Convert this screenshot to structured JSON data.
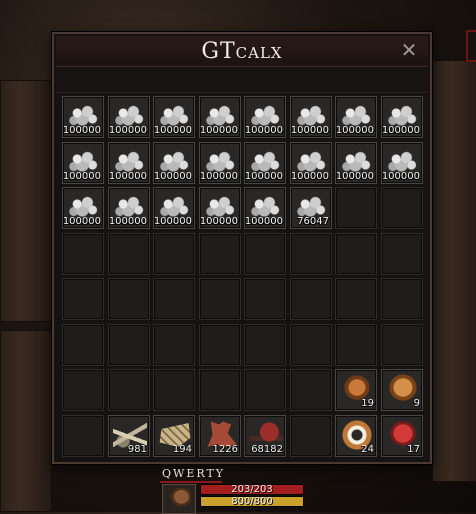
{
  "window": {
    "title": "GTcalx",
    "close_icon": "close-icon"
  },
  "inventory": {
    "columns": 8,
    "rows": 8,
    "slots": [
      {
        "row": 0,
        "col": 0,
        "icon": "ore",
        "qty": "100000"
      },
      {
        "row": 0,
        "col": 1,
        "icon": "ore",
        "qty": "100000"
      },
      {
        "row": 0,
        "col": 2,
        "icon": "ore",
        "qty": "100000"
      },
      {
        "row": 0,
        "col": 3,
        "icon": "ore",
        "qty": "100000"
      },
      {
        "row": 0,
        "col": 4,
        "icon": "ore",
        "qty": "100000"
      },
      {
        "row": 0,
        "col": 5,
        "icon": "ore",
        "qty": "100000"
      },
      {
        "row": 0,
        "col": 6,
        "icon": "ore",
        "qty": "100000"
      },
      {
        "row": 0,
        "col": 7,
        "icon": "ore",
        "qty": "100000"
      },
      {
        "row": 1,
        "col": 0,
        "icon": "ore",
        "qty": "100000"
      },
      {
        "row": 1,
        "col": 1,
        "icon": "ore",
        "qty": "100000"
      },
      {
        "row": 1,
        "col": 2,
        "icon": "ore",
        "qty": "100000"
      },
      {
        "row": 1,
        "col": 3,
        "icon": "ore",
        "qty": "100000"
      },
      {
        "row": 1,
        "col": 4,
        "icon": "ore",
        "qty": "100000"
      },
      {
        "row": 1,
        "col": 5,
        "icon": "ore",
        "qty": "100000"
      },
      {
        "row": 1,
        "col": 6,
        "icon": "ore",
        "qty": "100000"
      },
      {
        "row": 1,
        "col": 7,
        "icon": "ore",
        "qty": "100000"
      },
      {
        "row": 2,
        "col": 0,
        "icon": "ore",
        "qty": "100000"
      },
      {
        "row": 2,
        "col": 1,
        "icon": "ore",
        "qty": "100000"
      },
      {
        "row": 2,
        "col": 2,
        "icon": "ore",
        "qty": "100000"
      },
      {
        "row": 2,
        "col": 3,
        "icon": "ore",
        "qty": "100000"
      },
      {
        "row": 2,
        "col": 4,
        "icon": "ore",
        "qty": "100000"
      },
      {
        "row": 2,
        "col": 5,
        "icon": "ore",
        "qty": "76047"
      },
      {
        "row": 6,
        "col": 6,
        "icon": "meat",
        "qty": "19"
      },
      {
        "row": 6,
        "col": 7,
        "icon": "meat2",
        "qty": "9"
      },
      {
        "row": 7,
        "col": 1,
        "icon": "bones",
        "qty": "981"
      },
      {
        "row": 7,
        "col": 2,
        "icon": "logs",
        "qty": "194"
      },
      {
        "row": 7,
        "col": 3,
        "icon": "leather",
        "qty": "1226"
      },
      {
        "row": 7,
        "col": 4,
        "icon": "hide",
        "qty": "68182"
      },
      {
        "row": 7,
        "col": 6,
        "icon": "donut",
        "qty": "24"
      },
      {
        "row": 7,
        "col": 7,
        "icon": "armor",
        "qty": "17"
      }
    ]
  },
  "character": {
    "name": "QWERTY",
    "portrait_icon": "horse-icon",
    "health": {
      "text": "203/203",
      "fraction": 1.0,
      "color": "#a51e1e"
    },
    "stamina": {
      "text": "800/800",
      "fraction": 1.0,
      "color": "#c9a02a"
    }
  }
}
